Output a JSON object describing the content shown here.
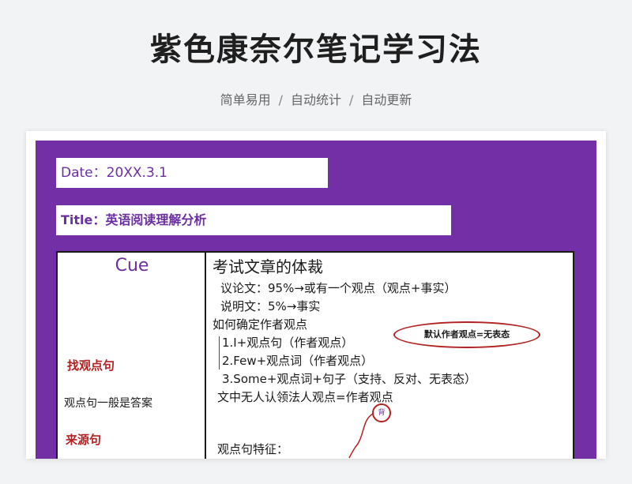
{
  "header": {
    "title": "紫色康奈尔笔记学习法",
    "features": [
      "简单易用",
      "自动统计",
      "自动更新"
    ],
    "separator": "/"
  },
  "date_field": {
    "text": "Date：20XX.3.1"
  },
  "title_field": {
    "text": "Title：英语阅读理解分析"
  },
  "cue": {
    "heading": "Cue",
    "items": [
      {
        "text": "找观点句",
        "color": "#b22222"
      },
      {
        "text": "观点句一般是答案",
        "color": "#1a1a1a"
      },
      {
        "text": "来源句",
        "color": "#b22222"
      }
    ]
  },
  "notes": {
    "heading": "考试文章的体裁",
    "lines": [
      "议论文：95%→或有一个观点（观点+事实）",
      "说明文：5%→事实",
      "如何确定作者观点",
      "1.I+观点句（作者观点）",
      "2.Few+观点词（作者观点）",
      "3.Some+观点词+句子（支持、反对、无表态）",
      "文中无人认领法人观点=作者观点",
      "观点句特征："
    ]
  },
  "annotations": {
    "oval_text": "默认作者观点=无表态",
    "circle_text": "背"
  },
  "colors": {
    "background": "#7330a6",
    "accent_red": "#b22222",
    "purple_text": "#6b2fa0"
  }
}
